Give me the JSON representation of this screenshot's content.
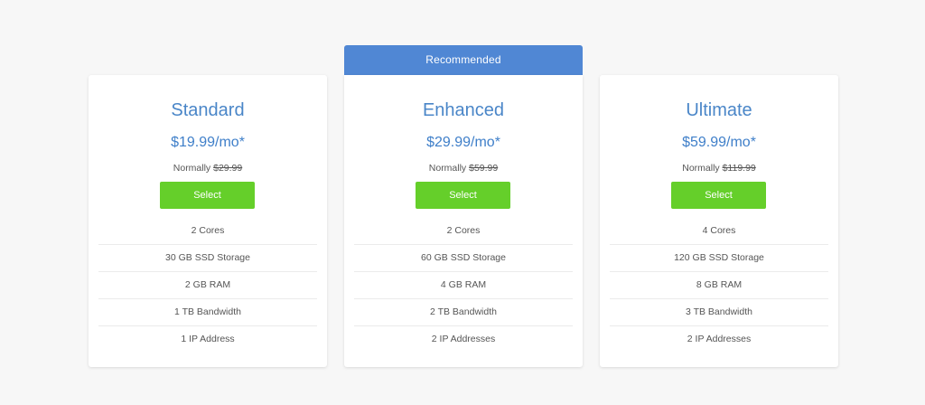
{
  "banner": {
    "label": "Recommended"
  },
  "plans": [
    {
      "name": "Standard",
      "price": "$19.99/mo*",
      "normally_label": "Normally",
      "normally_price": "$29.99",
      "button_label": "Select",
      "features": [
        "2 Cores",
        "30 GB SSD Storage",
        "2 GB RAM",
        "1 TB Bandwidth",
        "1 IP Address"
      ]
    },
    {
      "name": "Enhanced",
      "price": "$29.99/mo*",
      "normally_label": "Normally",
      "normally_price": "$59.99",
      "button_label": "Select",
      "features": [
        "2 Cores",
        "60 GB SSD Storage",
        "4 GB RAM",
        "2 TB Bandwidth",
        "2 IP Addresses"
      ]
    },
    {
      "name": "Ultimate",
      "price": "$59.99/mo*",
      "normally_label": "Normally",
      "normally_price": "$119.99",
      "button_label": "Select",
      "features": [
        "4 Cores",
        "120 GB SSD Storage",
        "8 GB RAM",
        "3 TB Bandwidth",
        "2 IP Addresses"
      ]
    }
  ],
  "colors": {
    "accent": "#5087d4",
    "plan_text": "#4a86c8",
    "button": "#65cf2a",
    "background": "#f7f7f7"
  }
}
